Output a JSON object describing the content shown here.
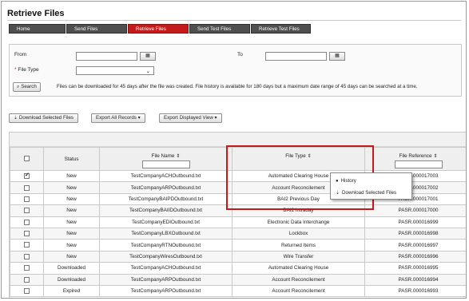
{
  "page": {
    "title": "Retrieve Files"
  },
  "tabs": [
    {
      "label": "Home",
      "active": false
    },
    {
      "label": "Send Files",
      "active": false
    },
    {
      "label": "Retrieve Files",
      "active": true
    },
    {
      "label": "Send Test Files",
      "active": false
    },
    {
      "label": "Retrieve Test Files",
      "active": false
    }
  ],
  "filters": {
    "from_label": "From",
    "to_label": "To",
    "file_type_label": "File Type",
    "required_marker": "*",
    "from_value": "",
    "to_value": "",
    "file_type_value": "",
    "search_label": "Search",
    "hint": "Files can be downloaded for 45 days after the file was created. File history is available for 180 days but a maximum date range of 45 days can be searched at a time."
  },
  "toolbar": {
    "download_selected": "Download Selected Files",
    "export_all": "Export All Records",
    "export_displayed": "Export Displayed View"
  },
  "grid": {
    "headers": {
      "status": "Status",
      "file_name": "File Name",
      "file_type": "File Type",
      "file_reference": "File Reference"
    },
    "rows": [
      {
        "checked": true,
        "status": "New",
        "file_name": "TestCompanyACHOutbound.txt",
        "file_type": "Automated Clearing House",
        "file_reference": "PASR.000017003"
      },
      {
        "checked": false,
        "status": "New",
        "file_name": "TestCompanyARPOutbound.txt",
        "file_type": "Account Reconcilement",
        "file_reference": "PASR.000017002"
      },
      {
        "checked": false,
        "status": "New",
        "file_name": "TestCompanyBAIPDOutbound.txt",
        "file_type": "BAI2 Previous Day",
        "file_reference": "PASR.000017001"
      },
      {
        "checked": false,
        "status": "New",
        "file_name": "TestCompanyBAIIDOutbound.txt",
        "file_type": "BAI2 Intraday",
        "file_reference": "PASR.000017000"
      },
      {
        "checked": false,
        "status": "New",
        "file_name": "TestCompanyEDIOutbound.txt",
        "file_type": "Electronic Data Interchange",
        "file_reference": "PASR.000016999"
      },
      {
        "checked": false,
        "status": "New",
        "file_name": "TestCompanyLBXOutbound.txt",
        "file_type": "Lockbox",
        "file_reference": "PASR.000016998"
      },
      {
        "checked": false,
        "status": "New",
        "file_name": "TestCompanyRTNOutbound.txt",
        "file_type": "Returned Items",
        "file_reference": "PASR.000016997"
      },
      {
        "checked": false,
        "status": "New",
        "file_name": "TestCompanyWiresOutbound.txt",
        "file_type": "Wire Transfer",
        "file_reference": "PASR.000016996"
      },
      {
        "checked": false,
        "status": "Downloaded",
        "file_name": "TestCompanyACHOutbound.txt",
        "file_type": "Automated Clearing House",
        "file_reference": "PASR.000016995"
      },
      {
        "checked": false,
        "status": "Downloaded",
        "file_name": "TestCompanyARPOutbound.txt",
        "file_type": "Account Reconcilement",
        "file_reference": "PASR.000016994"
      },
      {
        "checked": false,
        "status": "Expired",
        "file_name": "TestCompanyARPOutbound.txt",
        "file_type": "Account Reconcilement",
        "file_reference": "PASR.000016993"
      }
    ]
  },
  "context_menu": {
    "history": "History",
    "download_selected": "Download Selected Files"
  },
  "colors": {
    "accent": "#c51a1a",
    "tab_bg": "#4f4f4f"
  }
}
